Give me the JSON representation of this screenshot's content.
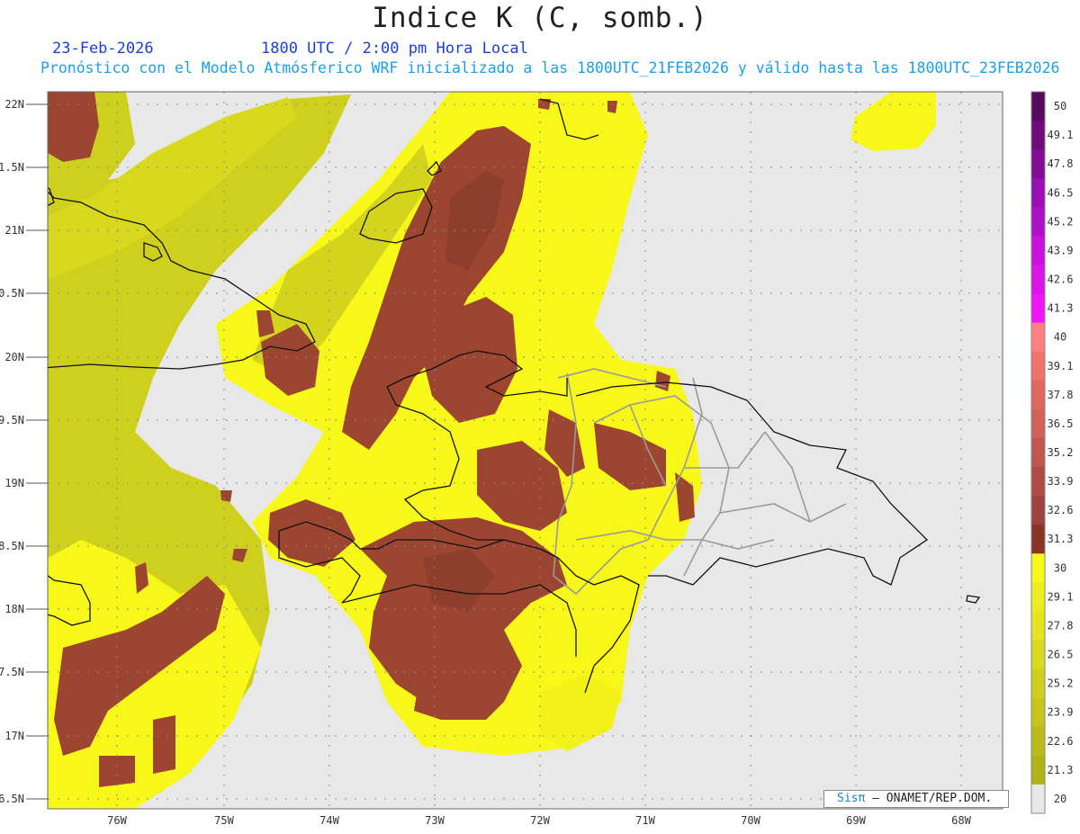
{
  "header": {
    "title": "Indice K (C, somb.)",
    "date": "23-Feb-2026",
    "time": "1800 UTC / 2:00 pm Hora Local",
    "forecast": "Pronóstico con el Modelo Atmósferico WRF inicializado a las 1800UTC_21FEB2026 y válido hasta las  1800UTC_23FEB2026"
  },
  "axes": {
    "lat_labels": [
      "22N",
      "1.5N",
      "21N",
      "0.5N",
      "20N",
      "9.5N",
      "19N",
      "8.5N",
      "18N",
      "7.5N",
      "17N",
      "6.5N"
    ],
    "lon_labels": [
      "76W",
      "75W",
      "74W",
      "73W",
      "72W",
      "71W",
      "70W",
      "69W",
      "68W"
    ]
  },
  "colorbar": {
    "labels": [
      "50",
      "49.1",
      "47.8",
      "46.5",
      "45.2",
      "43.9",
      "42.6",
      "41.3",
      "40",
      "39.1",
      "37.8",
      "36.5",
      "35.2",
      "33.9",
      "32.6",
      "31.3",
      "30",
      "29.1",
      "27.8",
      "26.5",
      "25.2",
      "23.9",
      "22.6",
      "21.3",
      "20"
    ],
    "colors": [
      "#5a0a5e",
      "#6e0a7a",
      "#820c96",
      "#9a0eb4",
      "#b010c8",
      "#c812dc",
      "#dc14ea",
      "#f016f8",
      "#ff8080",
      "#f0706a",
      "#e06660",
      "#d06058",
      "#c05650",
      "#b04c46",
      "#a0423c",
      "#8a3428",
      "#f7f71a",
      "#eded1e",
      "#e3e320",
      "#d9d920",
      "#cfcf1e",
      "#c5c51c",
      "#bbbb1a",
      "#b1b118",
      "#e8e8e8"
    ]
  },
  "credit": {
    "logo": "Sisπ",
    "text": "– ONAMET/REP.DOM."
  },
  "colors": {
    "ocean": "#e8e8e8",
    "k_low": "#cfcf1e",
    "k_mid": "#f7f71a",
    "k_high": "#9c4632",
    "coast": "#111111",
    "borders": "#9a9a9a"
  }
}
